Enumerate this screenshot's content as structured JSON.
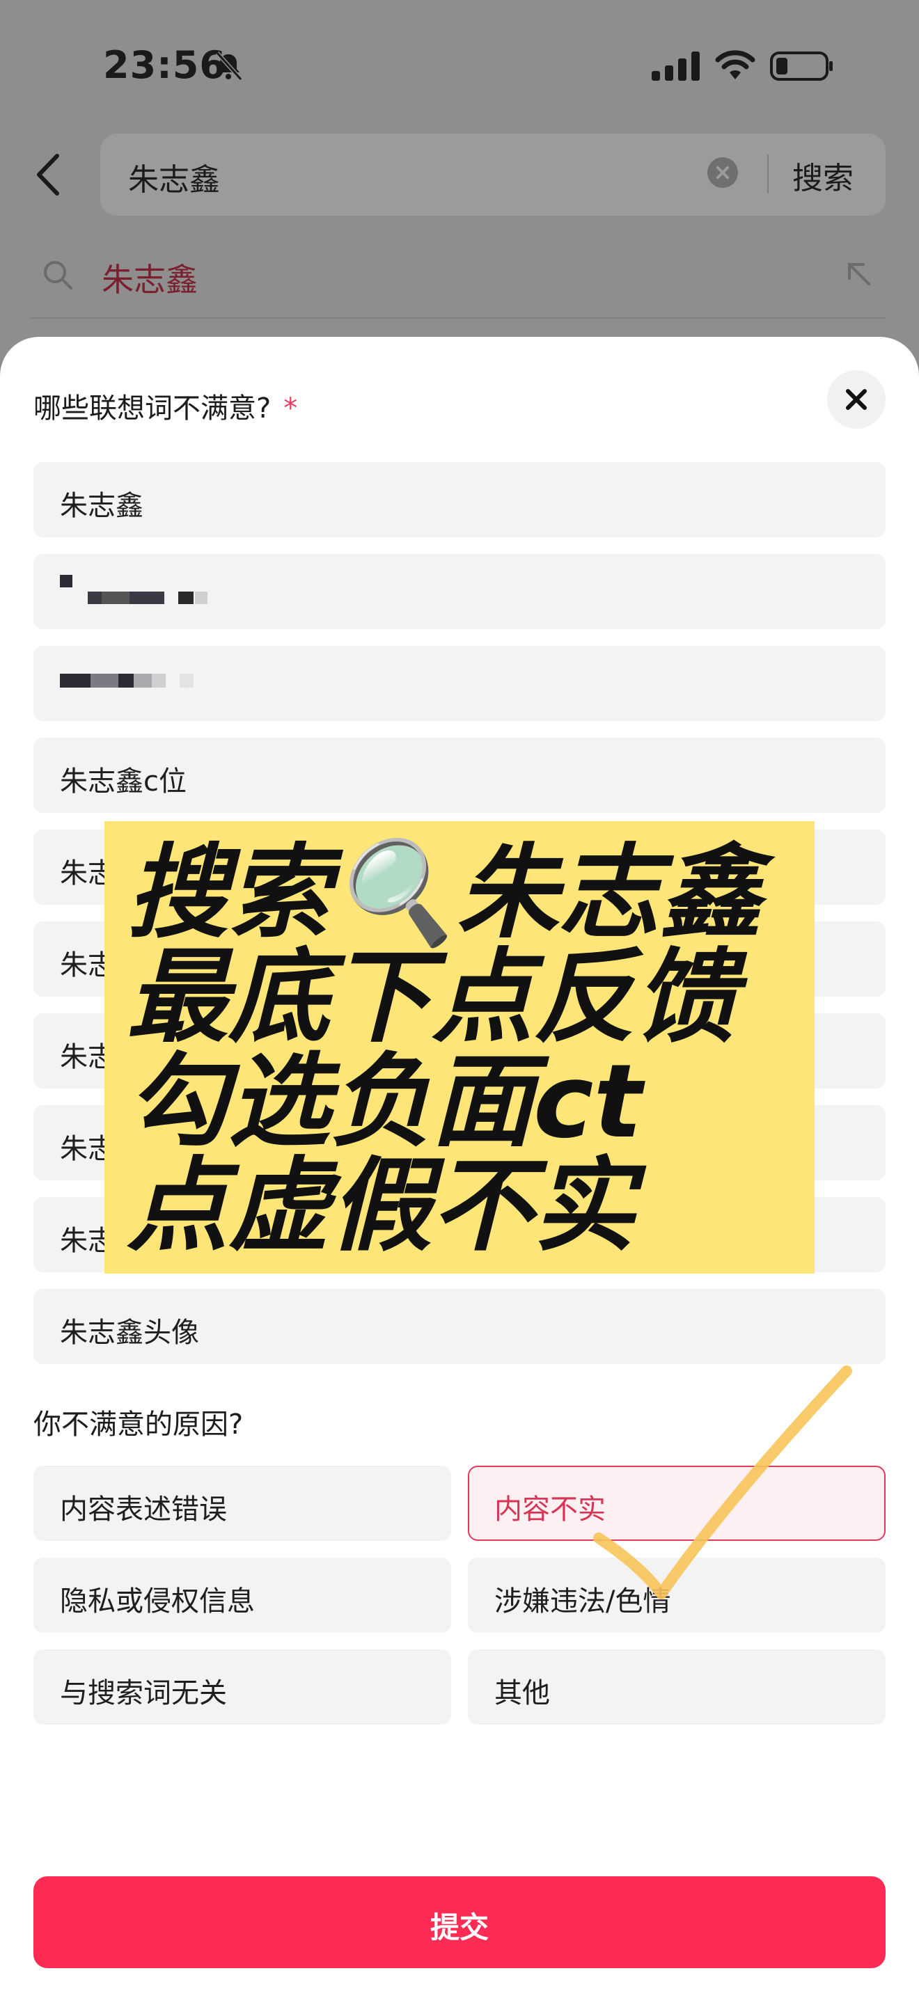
{
  "status_bar": {
    "time": "23:56"
  },
  "search": {
    "query": "朱志鑫",
    "button_label": "搜索"
  },
  "suggestion": {
    "text": "朱志鑫"
  },
  "sheet": {
    "question": "哪些联想词不满意?",
    "required_mark": "*",
    "options": [
      "朱志鑫",
      "",
      "",
      "朱志鑫c位",
      "朱志",
      "朱志",
      "朱志",
      "朱志",
      "朱志",
      "朱志鑫头像"
    ],
    "reason_title": "你不满意的原因?",
    "reasons": [
      "内容表述错误",
      "内容不实",
      "隐私或侵权信息",
      "涉嫌违法/色情",
      "与搜索词无关",
      "其他"
    ],
    "selected_reason": "内容不实",
    "submit_label": "提交"
  },
  "overlay": {
    "lines": [
      "搜索🔍朱志鑫",
      "最底下点反馈",
      "勾选负面ct",
      "点虚假不实"
    ],
    "background_color": "#fde677"
  },
  "colors": {
    "accent": "#fe2c55",
    "selected_text": "#d63556",
    "check_mark": "#f8c45a"
  }
}
